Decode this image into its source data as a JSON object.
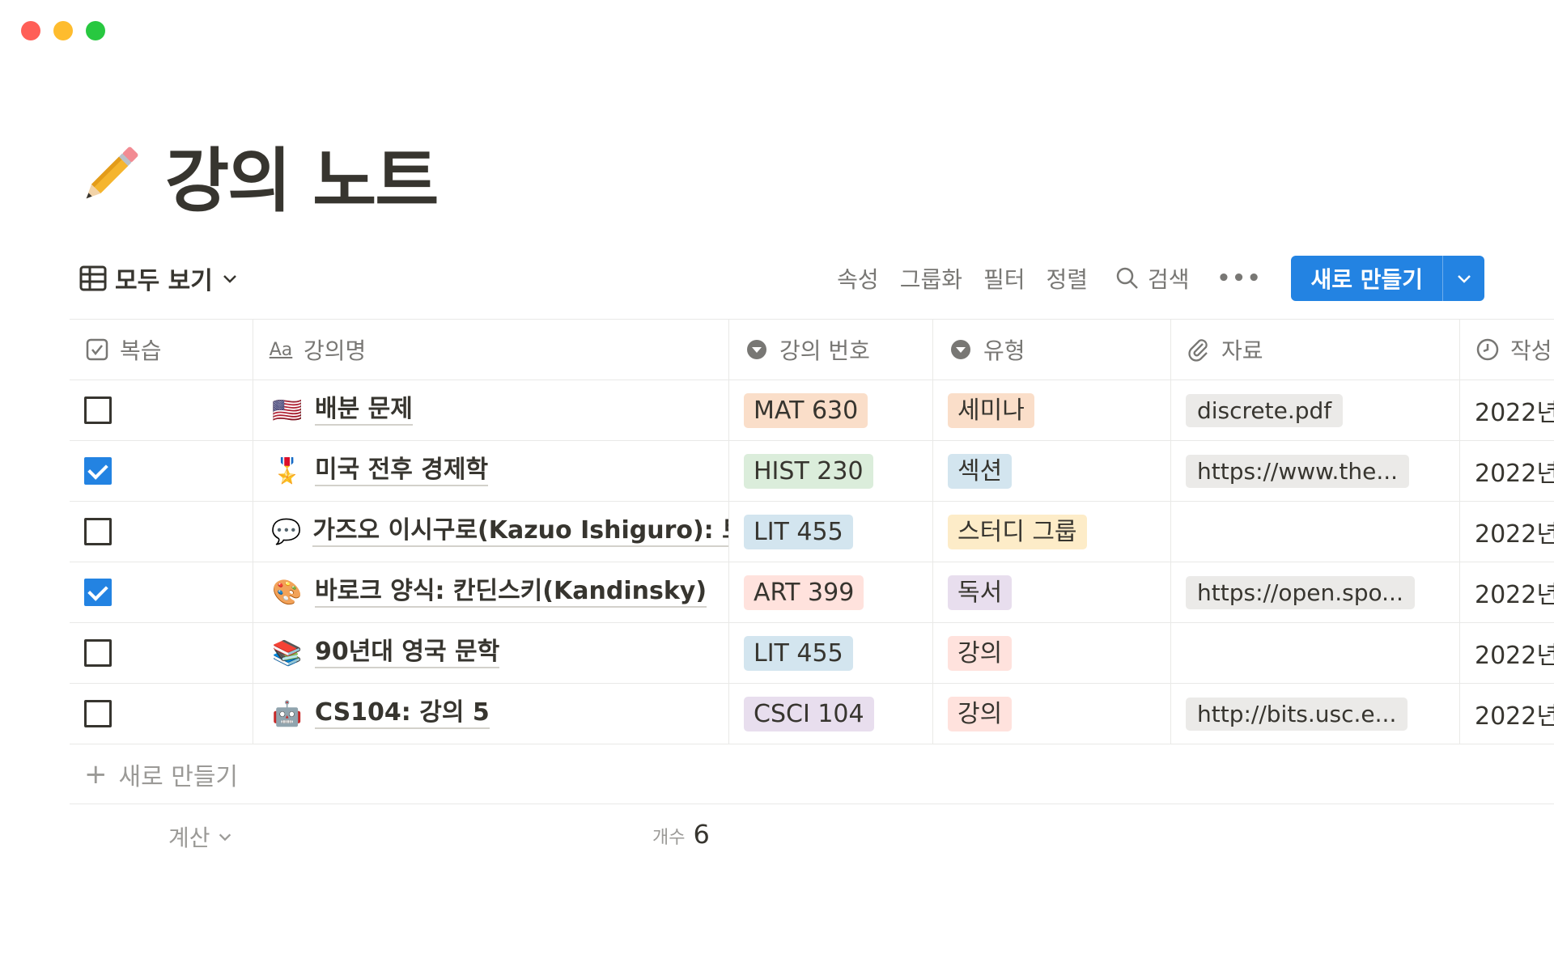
{
  "window": {
    "controls": [
      {
        "name": "close",
        "color": "#ff5f57"
      },
      {
        "name": "minimize",
        "color": "#febc2e"
      },
      {
        "name": "zoom",
        "color": "#28c840"
      }
    ]
  },
  "page": {
    "icon": "pencil-icon",
    "title": "강의 노트"
  },
  "toolbar": {
    "view_label": "모두 보기",
    "properties": "속성",
    "group": "그룹화",
    "filter": "필터",
    "sort": "정렬",
    "search": "검색",
    "more": "•••",
    "new_button": "새로 만들기",
    "accent_color": "#2383e2"
  },
  "columns": [
    {
      "label": "복습",
      "icon": "checkbox-icon"
    },
    {
      "label": "강의명",
      "icon": "text-aa-icon"
    },
    {
      "label": "강의 번호",
      "icon": "select-icon"
    },
    {
      "label": "유형",
      "icon": "select-icon"
    },
    {
      "label": "자료",
      "icon": "paperclip-icon"
    },
    {
      "label": "작성",
      "icon": "clock-icon"
    }
  ],
  "rows": [
    {
      "checked": false,
      "emoji": "🇺🇸",
      "name": "배분 문제",
      "course": "MAT 630",
      "course_bg": "#fadec9",
      "type": "세미나",
      "type_bg": "#fadec9",
      "file": "discrete.pdf",
      "date": "2022년"
    },
    {
      "checked": true,
      "emoji": "🎖️",
      "name": "미국 전후 경제학",
      "course": "HIST 230",
      "course_bg": "#dbeddb",
      "type": "섹션",
      "type_bg": "#d3e5ef",
      "file": "https://www.the...",
      "date": "2022년"
    },
    {
      "checked": false,
      "emoji": "💬",
      "name": "가즈오 이시구로(Kazuo Ishiguro): 토론",
      "course": "LIT 455",
      "course_bg": "#d3e5ef",
      "type": "스터디 그룹",
      "type_bg": "#fdecc8",
      "file": "",
      "date": "2022년"
    },
    {
      "checked": true,
      "emoji": "🎨",
      "name": "바로크 양식: 칸딘스키(Kandinsky)",
      "course": "ART 399",
      "course_bg": "#ffe2dd",
      "type": "독서",
      "type_bg": "#e8deee",
      "file": "https://open.spo...",
      "date": "2022년"
    },
    {
      "checked": false,
      "emoji": "📚",
      "name": "90년대 영국 문학",
      "course": "LIT 455",
      "course_bg": "#d3e5ef",
      "type": "강의",
      "type_bg": "#ffe2dd",
      "file": "",
      "date": "2022년"
    },
    {
      "checked": false,
      "emoji": "🤖",
      "name": "CS104: 강의 5",
      "course": "CSCI 104",
      "course_bg": "#e8deee",
      "type": "강의",
      "type_bg": "#ffe2dd",
      "file": "http://bits.usc.e...",
      "date": "2022년"
    }
  ],
  "new_row_label": "새로 만들기",
  "footer": {
    "calc_label": "계산",
    "count_label": "개수",
    "count_value": "6"
  }
}
